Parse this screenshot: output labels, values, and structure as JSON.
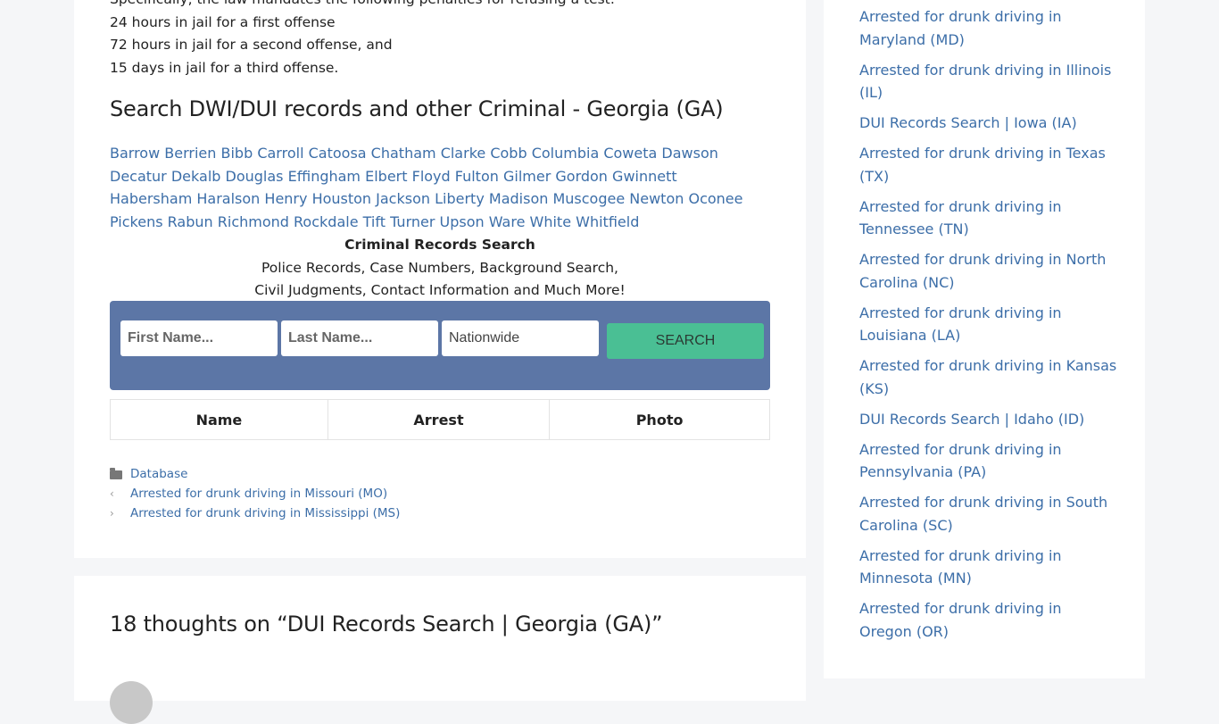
{
  "article": {
    "penalty_lines": [
      "Specifically, the law mandates the following penalties for refusing a test:",
      "24 hours in jail for a first offense",
      "72 hours in jail for a second offense, and",
      "15 days in jail for a third offense."
    ],
    "section_heading": "Search DWI/DUI records and other Criminal - Georgia (GA)",
    "counties": [
      "Barrow",
      "Berrien",
      "Bibb",
      "Carroll",
      "Catoosa",
      "Chatham",
      "Clarke",
      "Cobb",
      "Columbia",
      "Coweta",
      "Dawson",
      "Decatur",
      "Dekalb",
      "Douglas",
      "Effingham",
      "Elbert",
      "Floyd",
      "Fulton",
      "Gilmer",
      "Gordon",
      "Gwinnett",
      "Habersham",
      "Haralson",
      "Henry",
      "Houston",
      "Jackson",
      "Liberty",
      "Madison",
      "Muscogee",
      "Newton",
      "Oconee",
      "Pickens",
      "Rabun",
      "Richmond",
      "Rockdale",
      "Tift",
      "Turner",
      "Upson",
      "Ware",
      "White",
      "Whitfield"
    ],
    "promo": {
      "title": "Criminal Records Search",
      "line1": "Police Records, Case Numbers, Background Search,",
      "line2": "Civil Judgments, Contact Information and Much More!"
    },
    "search_form": {
      "first_name_placeholder": "First Name...",
      "last_name_placeholder": "Last Name...",
      "location_value": "Nationwide",
      "search_label": "SEARCH",
      "box_color": "#5c76a6",
      "button_color": "#4abf94"
    },
    "results_table": {
      "headers": [
        "Name",
        "Arrest",
        "Photo"
      ]
    },
    "meta": {
      "category": "Database",
      "prev_post": "Arrested for drunk driving in Missouri (MO)",
      "next_post": "Arrested for drunk driving in Mississippi (MS)"
    }
  },
  "comments": {
    "title": "18 thoughts on “DUI Records Search | Georgia (GA)”"
  },
  "sidebar": {
    "links": [
      "Arrested for drunk driving in Maryland (MD)",
      "Arrested for drunk driving in Illinois (IL)",
      "DUI Records Search | Iowa (IA)",
      "Arrested for drunk driving in Texas (TX)",
      "Arrested for drunk driving in Tennessee (TN)",
      "Arrested for drunk driving in North Carolina (NC)",
      "Arrested for drunk driving in Louisiana (LA)",
      "Arrested for drunk driving in Kansas (KS)",
      "DUI Records Search | Idaho (ID)",
      "Arrested for drunk driving in Pennsylvania (PA)",
      "Arrested for drunk driving in South Carolina (SC)",
      "Arrested for drunk driving in Minnesota (MN)",
      "Arrested for drunk driving in Oregon (OR)"
    ]
  },
  "colors": {
    "link": "#3c6ea8",
    "page_bg": "#f5f6f8"
  }
}
